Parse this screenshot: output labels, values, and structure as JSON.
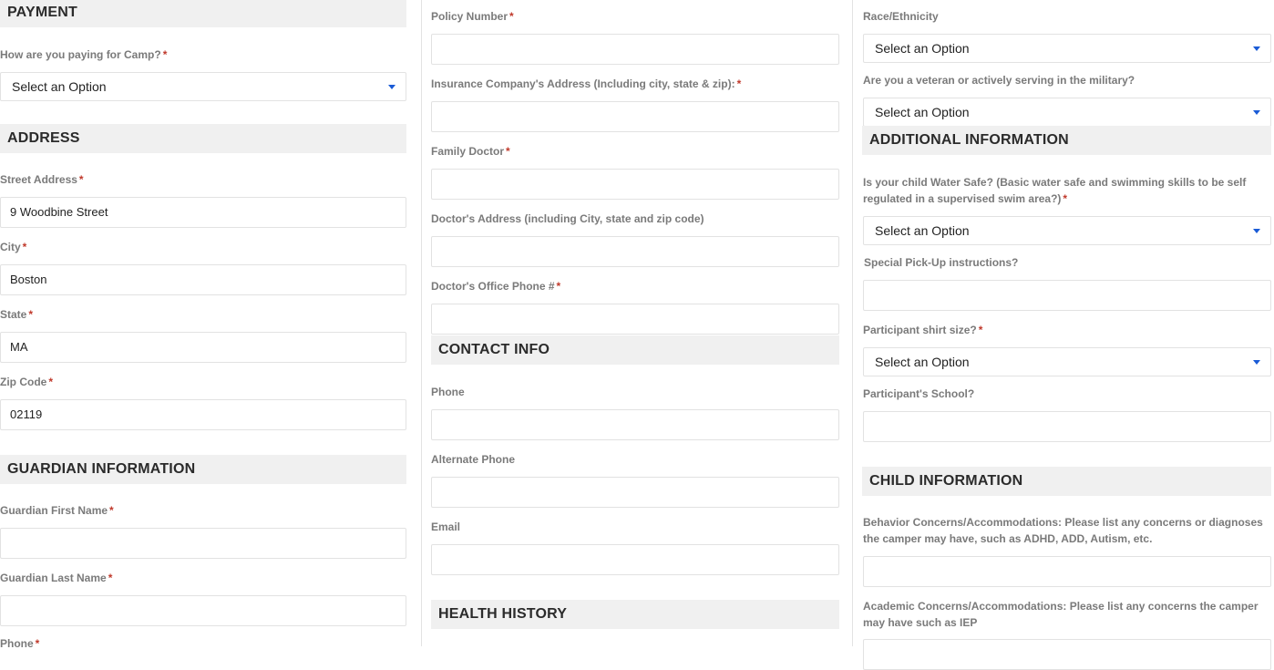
{
  "payment": {
    "heading": "PAYMENT",
    "paying_label": "How are you paying for Camp?",
    "paying_value": "Select an Option"
  },
  "address": {
    "heading": "ADDRESS",
    "street_label": "Street Address",
    "street_value": "9 Woodbine Street",
    "city_label": "City",
    "city_value": "Boston",
    "state_label": "State",
    "state_value": "MA",
    "zip_label": "Zip Code",
    "zip_value": "02119"
  },
  "guardian": {
    "heading": "GUARDIAN INFORMATION",
    "first_label": "Guardian First Name",
    "last_label": "Guardian Last Name",
    "phone_label": "Phone"
  },
  "insurance": {
    "policy_label": "Policy Number",
    "company_address_label": "Insurance Company's Address (Including city, state & zip):",
    "doctor_label": "Family Doctor",
    "doctor_address_label": "Doctor's Address (including City, state and zip code)",
    "doctor_phone_label": "Doctor's Office Phone #"
  },
  "contact": {
    "heading": "CONTACT INFO",
    "phone_label": "Phone",
    "alt_phone_label": "Alternate Phone",
    "email_label": "Email"
  },
  "health": {
    "heading": "HEALTH HISTORY"
  },
  "demographics": {
    "race_label": "Race/Ethnicity",
    "race_value": "Select an Option",
    "veteran_label": "Are you a veteran or actively serving in the military?",
    "veteran_value": "Select an Option"
  },
  "additional": {
    "heading": "ADDITIONAL INFORMATION",
    "water_label": "Is your child Water Safe? (Basic water safe and swimming skills to be self regulated in a supervised swim area?)",
    "water_value": "Select an Option",
    "pickup_label": "Special Pick-Up instructions?",
    "shirt_label": "Participant shirt size?",
    "shirt_value": "Select an Option",
    "school_label": "Participant's School?"
  },
  "child": {
    "heading": "CHILD INFORMATION",
    "behavior_label": "Behavior Concerns/Accommodations: Please list any concerns or diagnoses the camper may have, such as ADHD, ADD, Autism, etc.",
    "academic_label": "Academic Concerns/Accommodations: Please list any concerns the camper may have such as IEP"
  },
  "required_mark": "*",
  "colors": {
    "section_bg": "#f0f0f0",
    "label_text": "#7a7a7a",
    "required": "#c0392b",
    "dropdown_arrow": "#1a5bd6"
  }
}
